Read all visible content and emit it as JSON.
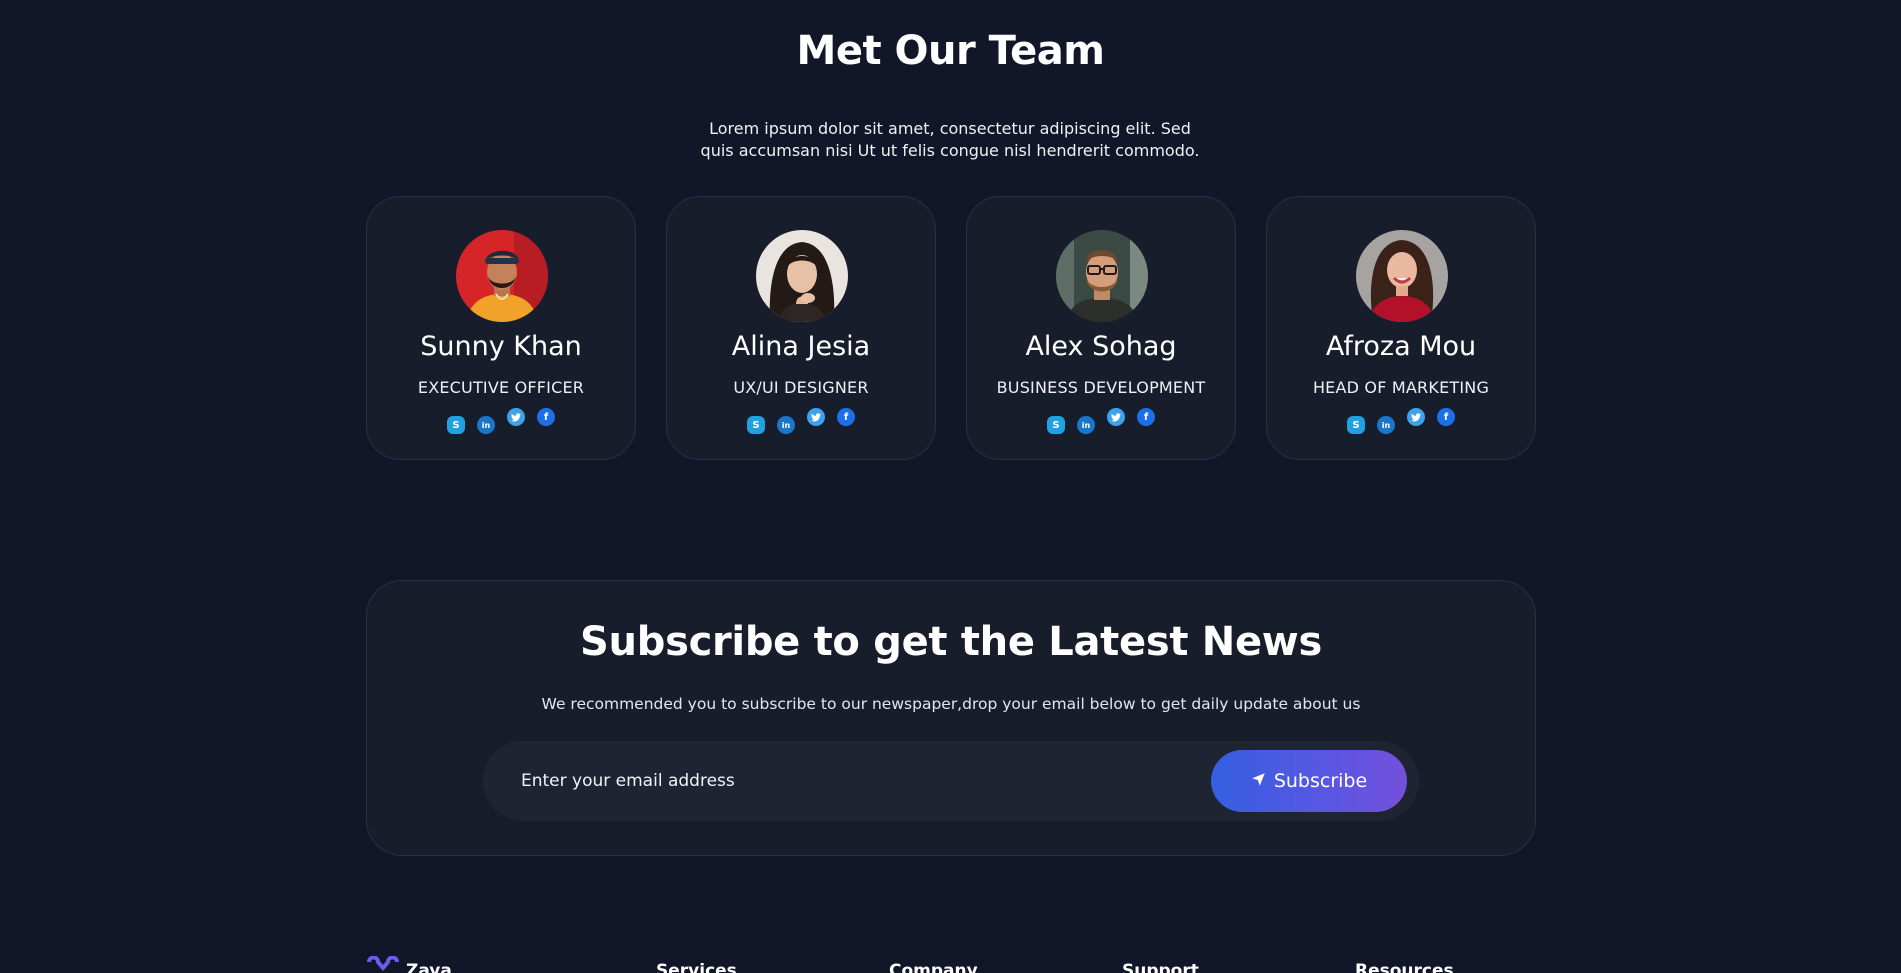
{
  "team": {
    "title": "Met Our Team",
    "subtitle": "Lorem ipsum dolor sit amet, consectetur adipiscing elit. Sed quis accumsan nisi Ut ut felis congue nisl hendrerit commodo.",
    "members": [
      {
        "name": "Sunny Khan",
        "role": "EXECUTIVE OFFICER"
      },
      {
        "name": "Alina Jesia",
        "role": "UX/UI DESIGNER"
      },
      {
        "name": "Alex Sohag",
        "role": "BUSINESS DEVELOPMENT"
      },
      {
        "name": "Afroza Mou",
        "role": "HEAD OF MARKETING"
      }
    ],
    "social_icons": [
      "skype-icon",
      "linkedin-icon",
      "twitter-icon",
      "facebook-icon"
    ]
  },
  "subscribe": {
    "title": "Subscribe to get the Latest News",
    "description": "We recommended you to subscribe to our newspaper,drop your email below to get daily update about us",
    "input_placeholder": "Enter your email address",
    "button_label": "Subscribe"
  },
  "footer": {
    "logo_text": "Zaya",
    "columns": [
      "Services",
      "Company",
      "Support",
      "Resources"
    ]
  },
  "colors": {
    "background": "#111628",
    "card": "#181d2c",
    "button_gradient_start": "#3460e0",
    "button_gradient_end": "#7450db"
  }
}
